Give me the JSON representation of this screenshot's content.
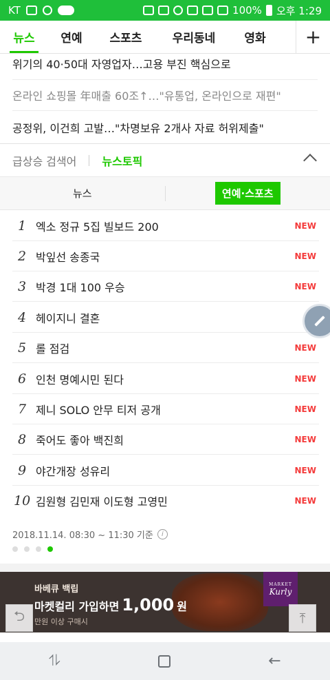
{
  "status_bar": {
    "carrier": "KT",
    "battery": "100%",
    "time": "오후 1:29"
  },
  "nav_tabs": [
    "뉴스",
    "연예",
    "스포츠",
    "우리동네",
    "영화"
  ],
  "nav_plus": "+",
  "headlines": [
    "위기의 40·50대 자영업자…고용 부진 핵심으로",
    "온라인 쇼핑몰 年매출 60조↑…\"유통업, 온라인으로 재편\"",
    "공정위, 이건희 고발…\"차명보유 2개사 자료 허위제출\""
  ],
  "topic_tabs": {
    "rising": "급상승 검색어",
    "news_topic": "뉴스토픽"
  },
  "sub_tabs": {
    "news": "뉴스",
    "ent_sports": "연예·스포츠"
  },
  "ranking": [
    {
      "rank": "1",
      "text": "엑소 정규 5집 빌보드 200",
      "badge": "NEW"
    },
    {
      "rank": "2",
      "text": "박잎선 송종국",
      "badge": "NEW"
    },
    {
      "rank": "3",
      "text": "박경 1대 100 우승",
      "badge": "NEW"
    },
    {
      "rank": "4",
      "text": "헤이지니 결혼",
      "badge": ""
    },
    {
      "rank": "5",
      "text": "롤 점검",
      "badge": "NEW"
    },
    {
      "rank": "6",
      "text": "인천 명예시민 된다",
      "badge": "NEW"
    },
    {
      "rank": "7",
      "text": "제니 SOLO 안무 티저 공개",
      "badge": "NEW"
    },
    {
      "rank": "8",
      "text": "죽어도 좋아 백진희",
      "badge": "NEW"
    },
    {
      "rank": "9",
      "text": "야간개장 성유리",
      "badge": "NEW"
    },
    {
      "rank": "10",
      "text": "김원형 김민재 이도형 고영민",
      "badge": "NEW"
    }
  ],
  "updated": "2018.11.14. 08:30 ~ 11:30 기준",
  "info_label": "i",
  "page_dots": {
    "count": 4,
    "active_index": 3
  },
  "ad": {
    "tag": "바베큐 백립",
    "main": "마켓컬리 가입하면",
    "amount": "1,000",
    "unit": "원",
    "sub": "만원 이상 구매시",
    "logo_small": "MARKET",
    "logo": "Kurly"
  },
  "float_buttons": {
    "share": "⮌",
    "top": "⤒"
  },
  "system_nav": {
    "recent": "⥮",
    "back": "←"
  },
  "colors": {
    "brand": "#1ec800",
    "status_bar": "#1fbf3a",
    "new_badge": "#f43b3b"
  }
}
